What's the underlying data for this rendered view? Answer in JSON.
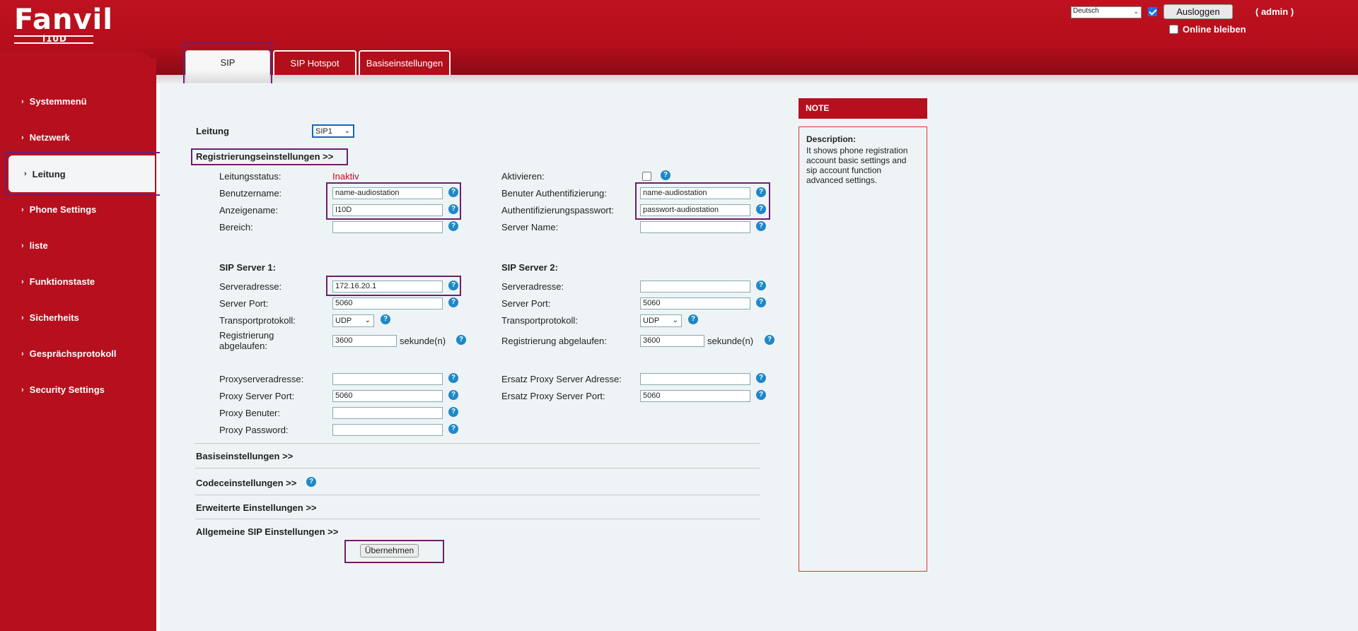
{
  "header": {
    "logo_brand": "Fanvil",
    "logo_model": "i10D",
    "language": "Deutsch",
    "logout_label": "Ausloggen",
    "admin_label": "( admin )",
    "stay_online_label": "Online bleiben"
  },
  "tabs": [
    {
      "label": "SIP",
      "active": true
    },
    {
      "label": "SIP Hotspot",
      "active": false
    },
    {
      "label": "Basiseinstellungen",
      "active": false
    }
  ],
  "sidebar": {
    "items": [
      {
        "label": "Systemmenü"
      },
      {
        "label": "Netzwerk"
      },
      {
        "label": "Leitung",
        "active": true
      },
      {
        "label": "Phone Settings"
      },
      {
        "label": "liste"
      },
      {
        "label": "Funktionstaste"
      },
      {
        "label": "Sicherheits"
      },
      {
        "label": "Gesprächsprotokoll"
      },
      {
        "label": "Security Settings"
      }
    ]
  },
  "form": {
    "line_label": "Leitung",
    "line_value": "SIP1",
    "reg_section": "Registrierungseinstellungen >>",
    "status_label": "Leitungsstatus:",
    "status_value": "Inaktiv",
    "activate_label": "Aktivieren:",
    "username_label": "Benutzername:",
    "username_value": "name-audiostation",
    "auth_user_label": "Benuter Authentifizierung:",
    "auth_user_value": "name-audiostation",
    "display_name_label": "Anzeigename:",
    "display_name_value": "I10D",
    "auth_pass_label": "Authentifizierungspasswort:",
    "auth_pass_value": "passwort-audiostation",
    "realm_label": "Bereich:",
    "realm_value": "",
    "server_name_label": "Server Name:",
    "server_name_value": "",
    "server1_title": "SIP Server 1:",
    "server2_title": "SIP Server 2:",
    "s1_addr_label": "Serveradresse:",
    "s1_addr_value": "172.16.20.1",
    "s2_addr_label": "Serveradresse:",
    "s2_addr_value": "",
    "s1_port_label": "Server Port:",
    "s1_port_value": "5060",
    "s2_port_label": "Server Port:",
    "s2_port_value": "5060",
    "s1_transport_label": "Transportprotokoll:",
    "s1_transport_value": "UDP",
    "s2_transport_label": "Transportprotokoll:",
    "s2_transport_value": "UDP",
    "s1_reg_exp_label_1": "Registrierung",
    "s1_reg_exp_label_2": "abgelaufen:",
    "s1_reg_exp_value": "3600",
    "s2_reg_exp_label": "Registrierung abgelaufen:",
    "s2_reg_exp_value": "3600",
    "seconds_label": "sekunde(n)",
    "proxy_addr_label": "Proxyserveradresse:",
    "proxy_addr_value": "",
    "backup_proxy_addr_label": "Ersatz Proxy Server Adresse:",
    "backup_proxy_addr_value": "",
    "proxy_port_label": "Proxy Server Port:",
    "proxy_port_value": "5060",
    "backup_proxy_port_label": "Ersatz Proxy Server Port:",
    "backup_proxy_port_value": "5060",
    "proxy_user_label": "Proxy Benuter:",
    "proxy_user_value": "",
    "proxy_pass_label": "Proxy Password:",
    "proxy_pass_value": "",
    "basic_section": "Basiseinstellungen >>",
    "codec_section": "Codeceinstellungen >>",
    "advanced_section": "Erweiterte Einstellungen >>",
    "general_sip_section": "Allgemeine SIP Einstellungen >>",
    "apply_label": "Übernehmen"
  },
  "note": {
    "title": "NOTE",
    "desc_title": "Description:",
    "desc_text": "It shows phone registration account basic settings and sip account function advanced settings."
  },
  "colors": {
    "brand_red": "#b60f1d",
    "content_bg": "#eef4f6",
    "help_blue": "#1e88c8",
    "status_red": "#d0021b"
  }
}
